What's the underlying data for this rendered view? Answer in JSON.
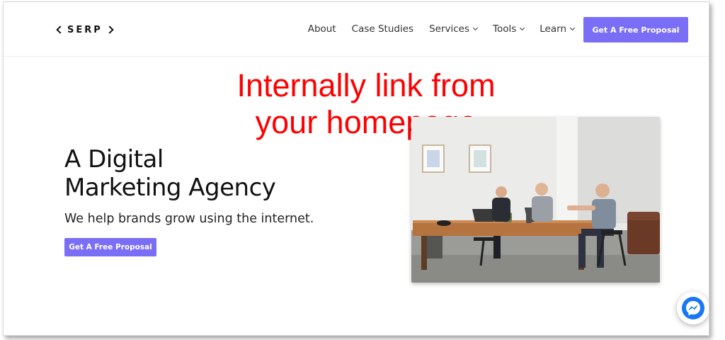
{
  "brand": {
    "logo": "SERP"
  },
  "nav": {
    "items": [
      {
        "label": "About"
      },
      {
        "label": "Case Studies"
      },
      {
        "label": "Services"
      },
      {
        "label": "Tools"
      },
      {
        "label": "Learn"
      }
    ],
    "cta": "Get A Free Proposal"
  },
  "annotation": {
    "line1": "Internally link from",
    "line2": "your homepage"
  },
  "hero": {
    "title_line1": "A Digital",
    "title_line2": "Marketing Agency",
    "subtitle": "We help brands grow using the internet.",
    "cta": "Get A Free Proposal"
  },
  "colors": {
    "accent": "#7b6ef6",
    "annotation": "#ff0000",
    "messenger": "#1877f2"
  },
  "icons": {
    "chat": "messenger-icon"
  }
}
